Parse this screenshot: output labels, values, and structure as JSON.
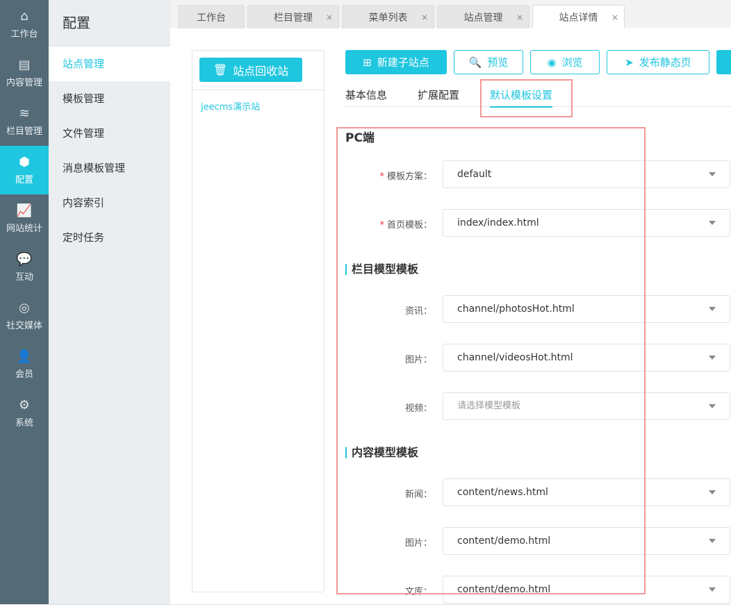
{
  "nav": [
    {
      "label": "工作台",
      "icon": "home-icon",
      "glyph": "⌂"
    },
    {
      "label": "内容管理",
      "icon": "document-icon",
      "glyph": "▤"
    },
    {
      "label": "栏目管理",
      "icon": "layers-icon",
      "glyph": "≋"
    },
    {
      "label": "配置",
      "icon": "cube-icon",
      "glyph": "⬢"
    },
    {
      "label": "网站统计",
      "icon": "chart-icon",
      "glyph": "📈"
    },
    {
      "label": "互动",
      "icon": "chat-icon",
      "glyph": "💬"
    },
    {
      "label": "社交媒体",
      "icon": "target-icon",
      "glyph": "◎"
    },
    {
      "label": "会员",
      "icon": "user-icon",
      "glyph": "👤"
    },
    {
      "label": "系统",
      "icon": "gear-icon",
      "glyph": "⚙"
    }
  ],
  "sub": {
    "title": "配置",
    "items": [
      "站点管理",
      "模板管理",
      "文件管理",
      "消息模板管理",
      "内容索引",
      "定时任务"
    ]
  },
  "tabs": [
    "工作台",
    "栏目管理",
    "菜单列表",
    "站点管理",
    "站点详情"
  ],
  "left": {
    "recycle": "站点回收站",
    "site": "jeecms演示站"
  },
  "buttons": {
    "new": "新建子站点",
    "preview": "预览",
    "browse": "浏览",
    "publish": "发布静态页"
  },
  "subtabs": [
    "基本信息",
    "扩展配置",
    "默认模板设置"
  ],
  "form": {
    "pc": "PC端",
    "scheme_label": "模板方案：",
    "scheme": "default",
    "index_label": "首页模板：",
    "index": "index/index.html",
    "channel_title": "栏目模型模板",
    "channel": [
      {
        "label": "资讯：",
        "value": "channel/photosHot.html"
      },
      {
        "label": "图片：",
        "value": "channel/videosHot.html"
      },
      {
        "label": "视频：",
        "value": "请选择模型模板"
      }
    ],
    "content_title": "内容模型模板",
    "content": [
      {
        "label": "新闻：",
        "value": "content/news.html"
      },
      {
        "label": "图片：",
        "value": "content/demo.html"
      },
      {
        "label": "文库：",
        "value": "content/demo.html"
      }
    ],
    "required_mark": "*"
  },
  "colors": {
    "accent": "#1fc6df",
    "nav_bg": "#546a76",
    "highlight": "#f29696"
  }
}
